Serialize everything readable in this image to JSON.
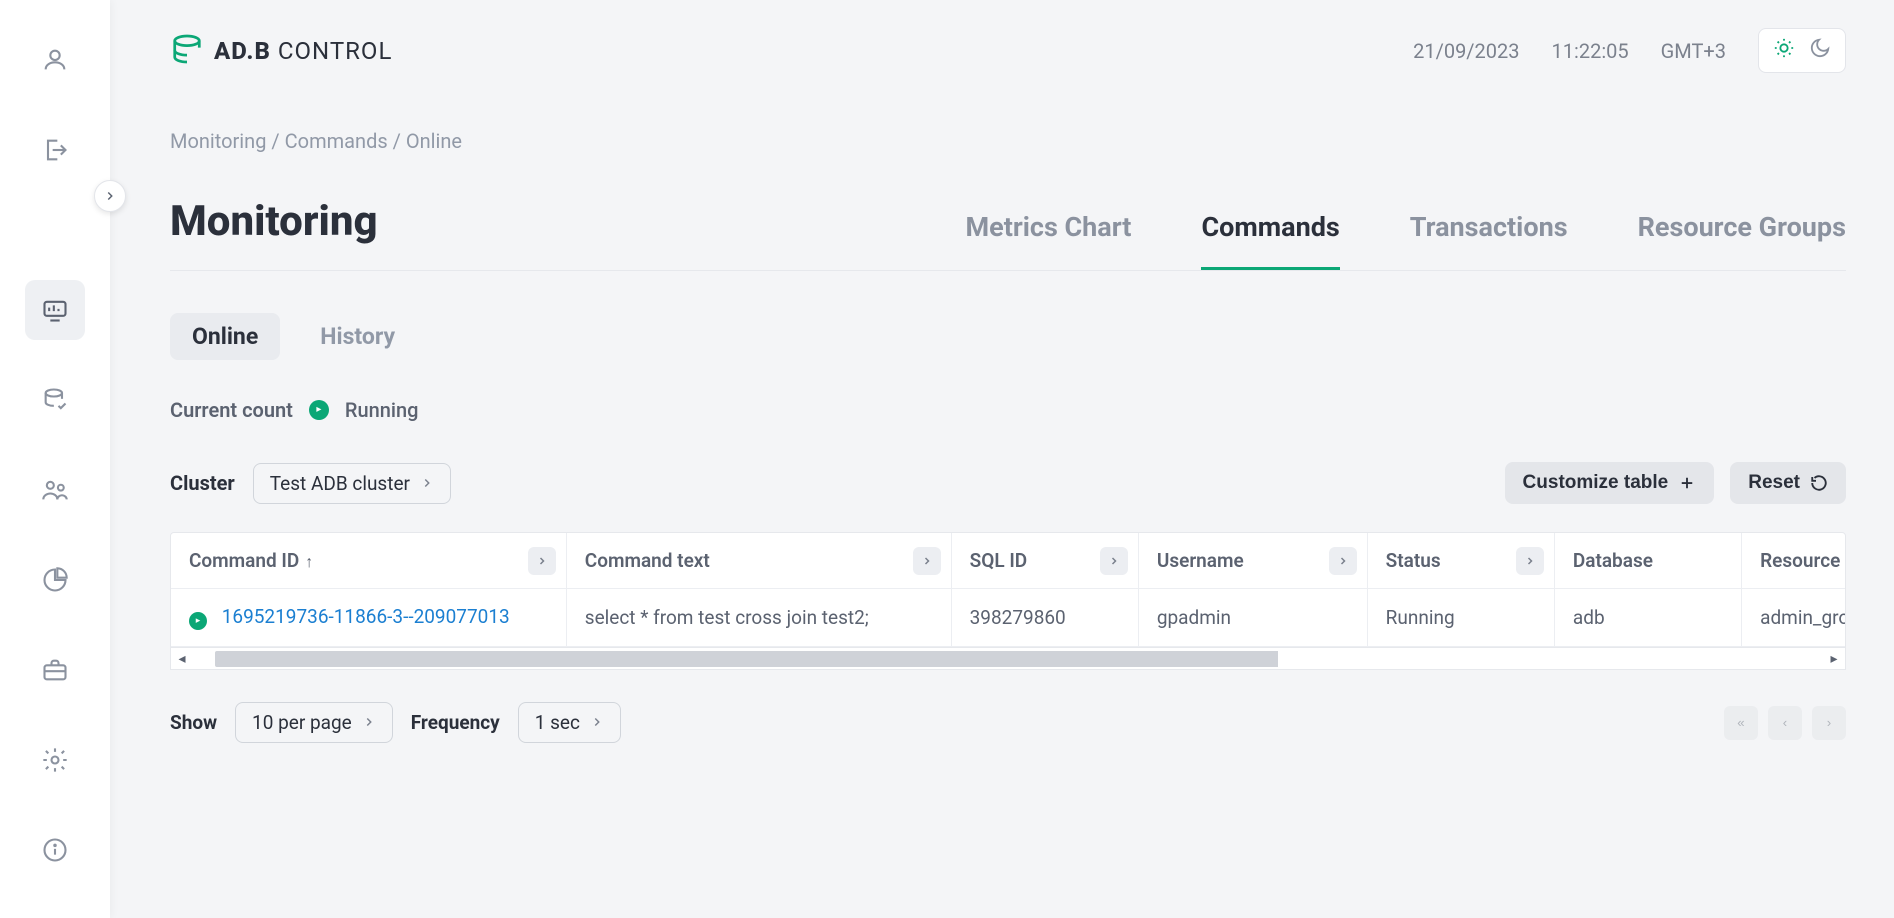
{
  "brand": {
    "part1": "AD.B ",
    "part2": "CONTROL"
  },
  "header": {
    "date": "21/09/2023",
    "time": "11:22:05",
    "tz": "GMT+3"
  },
  "breadcrumb": {
    "a": "Monitoring",
    "b": "Commands",
    "c": "Online",
    "sep": "/"
  },
  "page_title": "Monitoring",
  "main_tabs": {
    "metrics": "Metrics Chart",
    "commands": "Commands",
    "transactions": "Transactions",
    "resource_groups": "Resource Groups"
  },
  "subtabs": {
    "online": "Online",
    "history": "History"
  },
  "current_count": {
    "label": "Current count",
    "status_text": "Running"
  },
  "cluster": {
    "label": "Cluster",
    "value": "Test ADB cluster"
  },
  "buttons": {
    "customize": "Customize table",
    "reset": "Reset"
  },
  "table": {
    "headers": {
      "command_id": "Command ID",
      "command_text": "Command text",
      "sql_id": "SQL ID",
      "username": "Username",
      "status": "Status",
      "database": "Database",
      "resource_group": "Resource Group"
    },
    "row": {
      "command_id": "1695219736-11866-3--209077013",
      "command_text": "select * from test cross join test2;",
      "sql_id": "398279860",
      "username": "gpadmin",
      "status": "Running",
      "database": "adb",
      "resource_group": "admin_group"
    }
  },
  "footer": {
    "show_label": "Show",
    "show_value": "10 per page",
    "freq_label": "Frequency",
    "freq_value": "1 sec"
  }
}
